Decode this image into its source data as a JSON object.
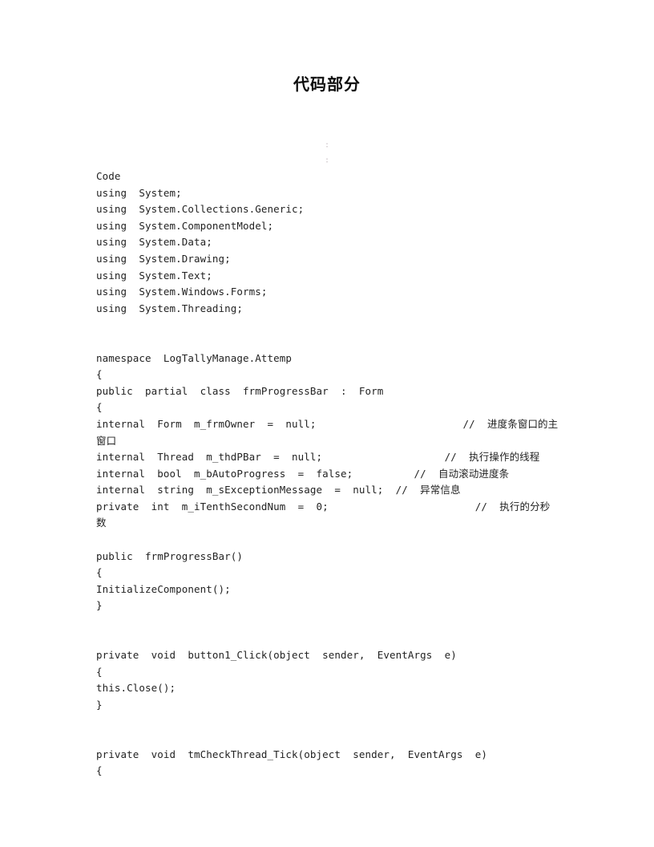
{
  "document": {
    "title": "代码部分",
    "faint_marks": [
      "∶",
      "∶"
    ],
    "code_label": "Code",
    "code_lines": [
      "Code",
      "using  System;",
      "using  System.Collections.Generic;",
      "using  System.ComponentModel;",
      "using  System.Data;",
      "using  System.Drawing;",
      "using  System.Text;",
      "using  System.Windows.Forms;",
      "using  System.Threading;",
      "",
      "",
      "namespace  LogTallyManage.Attemp",
      "{",
      "public  partial  class  frmProgressBar  :  Form",
      "{",
      "internal  Form  m_frmOwner  =  null;                        //  进度条窗口的主窗口",
      "internal  Thread  m_thdPBar  =  null;                    //  执行操作的线程",
      "internal  bool  m_bAutoProgress  =  false;          //  自动滚动进度条",
      "internal  string  m_sExceptionMessage  =  null;  //  异常信息",
      "private  int  m_iTenthSecondNum  =  0;                        //  执行的分秒数",
      "",
      "public  frmProgressBar()",
      "{",
      "InitializeComponent();",
      "}",
      "",
      "",
      "private  void  button1_Click(object  sender,  EventArgs  e)",
      "{",
      "this.Close();",
      "}",
      "",
      "",
      "private  void  tmCheckThread_Tick(object  sender,  EventArgs  e)",
      "{"
    ]
  }
}
